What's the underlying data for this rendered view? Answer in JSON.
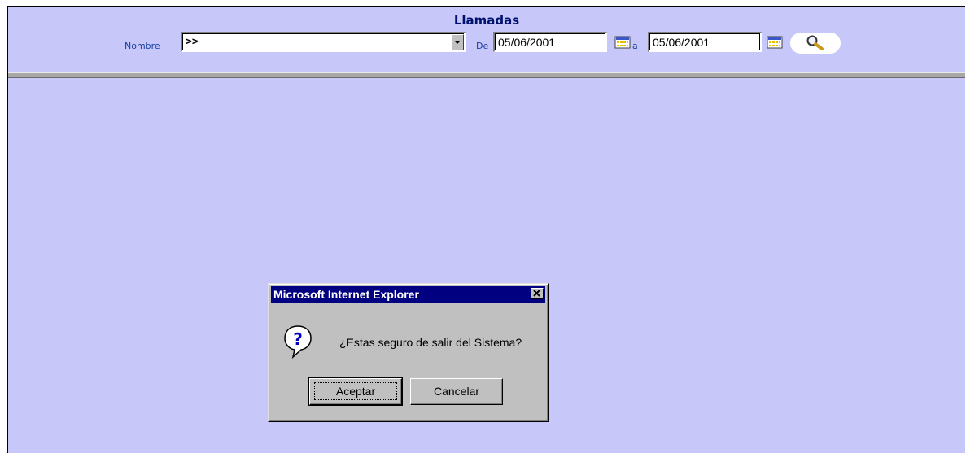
{
  "page": {
    "title": "Llamadas",
    "colors": {
      "background": "#c7c7f9",
      "title": "#00126e",
      "labels": "#1c3fa0"
    }
  },
  "filters": {
    "name_label": "Nombre",
    "name_value": ">>",
    "from_label": "De",
    "from_date": "05/06/2001",
    "to_label": "a",
    "to_date": "05/06/2001",
    "calendar_icon": "calendar-icon",
    "search_icon": "magnifier-icon"
  },
  "dialog": {
    "title": "Microsoft Internet Explorer",
    "message": "¿Estas seguro de salir del Sistema?",
    "icon": "question-icon",
    "ok_label": "Aceptar",
    "cancel_label": "Cancelar"
  }
}
